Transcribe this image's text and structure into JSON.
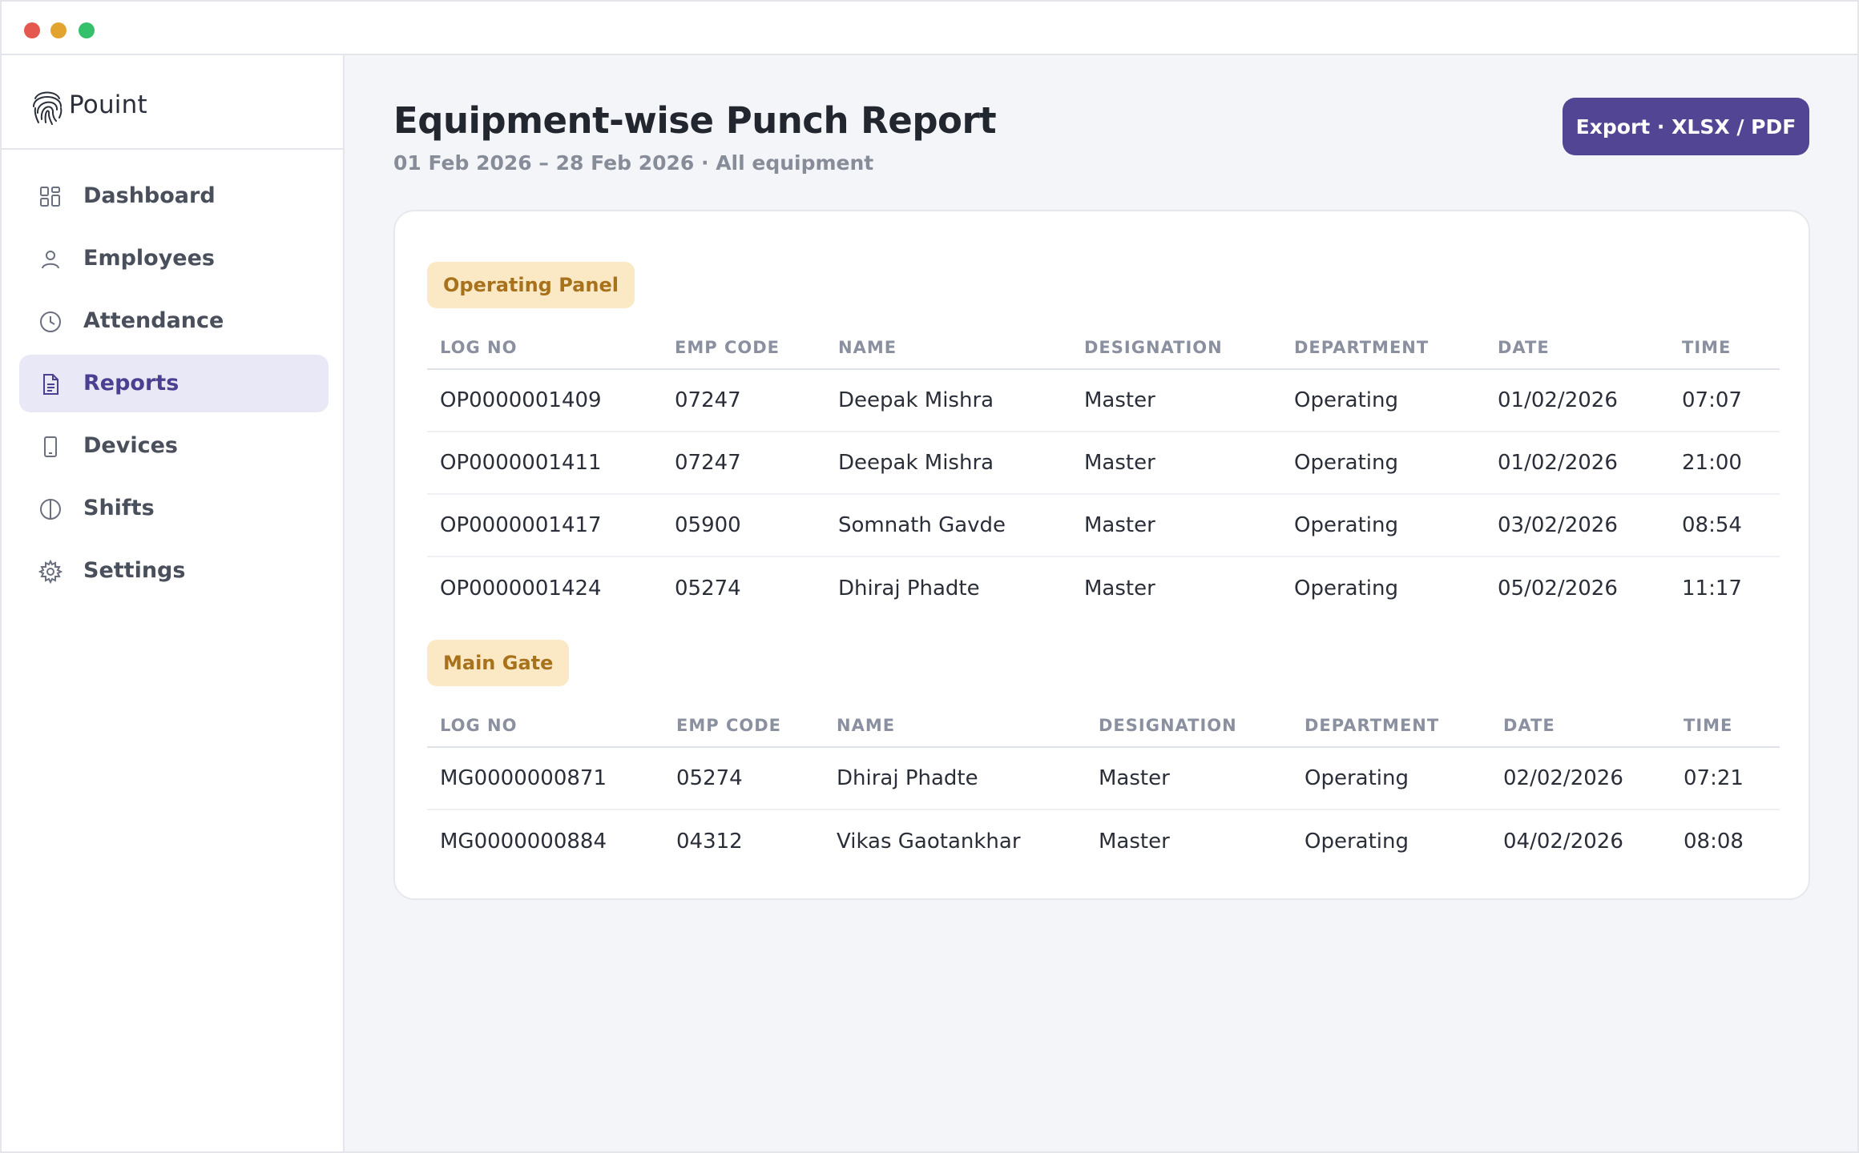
{
  "app": {
    "brand": "Pouint"
  },
  "sidebar": {
    "items": [
      {
        "label": "Dashboard",
        "icon": "grid-icon",
        "active": false
      },
      {
        "label": "Employees",
        "icon": "user-icon",
        "active": false
      },
      {
        "label": "Attendance",
        "icon": "clock-icon",
        "active": false
      },
      {
        "label": "Reports",
        "icon": "document-icon",
        "active": true
      },
      {
        "label": "Devices",
        "icon": "phone-icon",
        "active": false
      },
      {
        "label": "Shifts",
        "icon": "half-circle-icon",
        "active": false
      },
      {
        "label": "Settings",
        "icon": "gear-icon",
        "active": false
      }
    ]
  },
  "header": {
    "title": "Equipment-wise Punch Report",
    "subtitle": "01 Feb 2026 – 28 Feb 2026 · All equipment",
    "export_label": "Export · XLSX / PDF"
  },
  "colors": {
    "accent": "#524694",
    "active_bg": "#e9e8f7",
    "tag_bg": "#fbe8c4",
    "tag_text": "#a8721c"
  },
  "groups": [
    {
      "name": "Operating Panel",
      "columns": [
        "LOG NO",
        "EMP CODE",
        "NAME",
        "DESIGNATION",
        "DEPARTMENT",
        "DATE",
        "TIME"
      ],
      "rows": [
        [
          "OP0000001409",
          "07247",
          "Deepak Mishra",
          "Master",
          "Operating",
          "01/02/2026",
          "07:07"
        ],
        [
          "OP0000001411",
          "07247",
          "Deepak Mishra",
          "Master",
          "Operating",
          "01/02/2026",
          "21:00"
        ],
        [
          "OP0000001417",
          "05900",
          "Somnath Gavde",
          "Master",
          "Operating",
          "03/02/2026",
          "08:54"
        ],
        [
          "OP0000001424",
          "05274",
          "Dhiraj Phadte",
          "Master",
          "Operating",
          "05/02/2026",
          "11:17"
        ]
      ]
    },
    {
      "name": "Main Gate",
      "columns": [
        "LOG NO",
        "EMP CODE",
        "NAME",
        "DESIGNATION",
        "DEPARTMENT",
        "DATE",
        "TIME"
      ],
      "rows": [
        [
          "MG0000000871",
          "05274",
          "Dhiraj Phadte",
          "Master",
          "Operating",
          "02/02/2026",
          "07:21"
        ],
        [
          "MG0000000884",
          "04312",
          "Vikas Gaotankhar",
          "Master",
          "Operating",
          "04/02/2026",
          "08:08"
        ]
      ]
    }
  ]
}
